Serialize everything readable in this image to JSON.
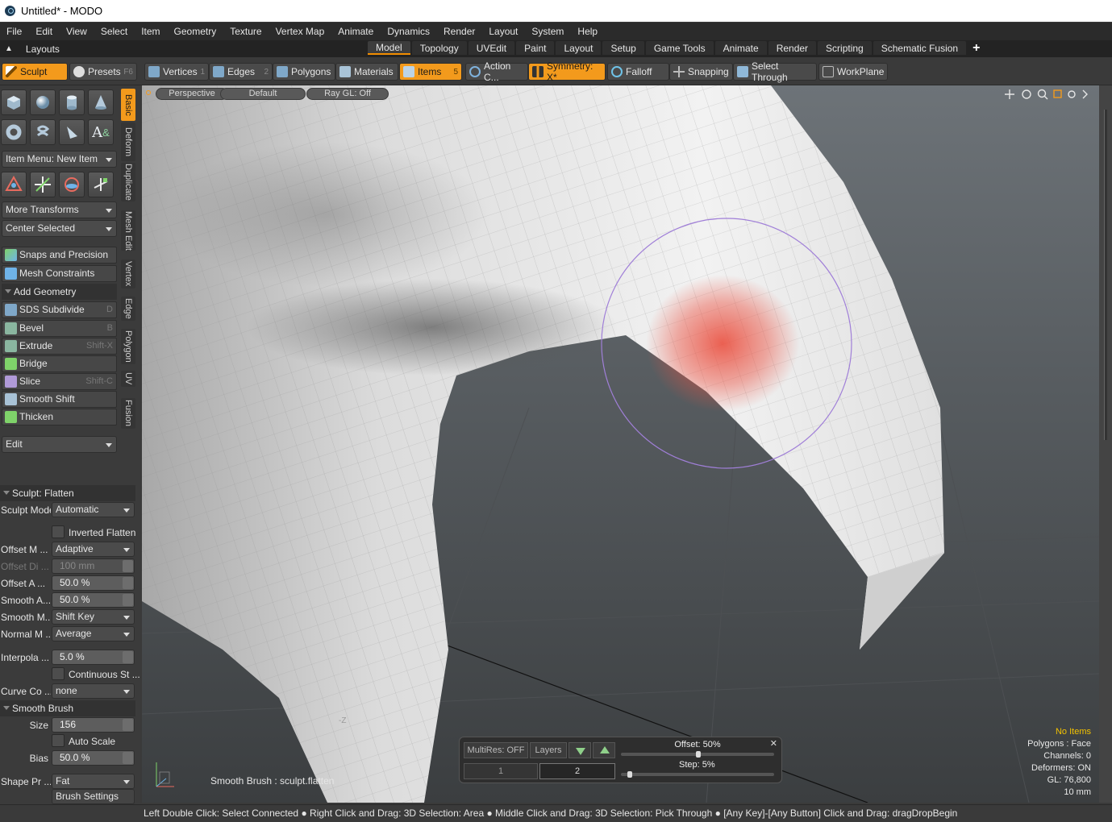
{
  "window": {
    "title": "Untitled* - MODO"
  },
  "menu": [
    "File",
    "Edit",
    "View",
    "Select",
    "Item",
    "Geometry",
    "Texture",
    "Vertex Map",
    "Animate",
    "Dynamics",
    "Render",
    "Layout",
    "System",
    "Help"
  ],
  "layouts_label": "Layouts",
  "layout_tabs": [
    "Model",
    "Topology",
    "UVEdit",
    "Paint",
    "Layout",
    "Setup",
    "Game Tools",
    "Animate",
    "Render",
    "Scripting",
    "Schematic Fusion"
  ],
  "active_layout_tab": "Model",
  "toolbar": {
    "sculpt": "Sculpt",
    "presets": "Presets",
    "presets_key": "F6",
    "vertices": "Vertices",
    "vertices_key": "1",
    "edges": "Edges",
    "edges_key": "2",
    "polygons": "Polygons",
    "materials": "Materials",
    "items": "Items",
    "items_key": "5",
    "action_center": "Action C...",
    "symmetry": "Symmetry: X*",
    "falloff": "Falloff",
    "snapping": "Snapping",
    "select_through": "Select Through",
    "workplane": "WorkPlane"
  },
  "left_panel": {
    "item_menu": "Item Menu: New Item",
    "more_transforms": "More Transforms",
    "center_selected": "Center Selected",
    "snaps": "Snaps and Precision",
    "mesh_constraints": "Mesh Constraints",
    "add_geometry": "Add Geometry",
    "tools": [
      {
        "label": "SDS Subdivide",
        "key": "D"
      },
      {
        "label": "Bevel",
        "key": "B"
      },
      {
        "label": "Extrude",
        "key": "Shift-X"
      },
      {
        "label": "Bridge",
        "key": ""
      },
      {
        "label": "Slice",
        "key": "Shift-C"
      },
      {
        "label": "Smooth Shift",
        "key": ""
      },
      {
        "label": "Thicken",
        "key": ""
      }
    ],
    "edit": "Edit"
  },
  "vertical_tabs": [
    "Basic",
    "Deform",
    "Duplicate",
    "Mesh Edit",
    "Vertex",
    "Edge",
    "Polygon",
    "UV",
    "Fusion"
  ],
  "sculpt_props": {
    "header": "Sculpt: Flatten",
    "sculpt_mode_label": "Sculpt Mode",
    "sculpt_mode": "Automatic",
    "inverted_flatten": "Inverted Flatten",
    "offset_mode_label": "Offset M ...",
    "offset_mode": "Adaptive",
    "offset_dist_label": "Offset Di ...",
    "offset_dist": "100 mm",
    "offset_amount_label": "Offset A ...",
    "offset_amount": "50.0 %",
    "smooth_amount_label": "Smooth A...",
    "smooth_amount": "50.0 %",
    "smooth_mode_label": "Smooth M...",
    "smooth_mode": "Shift Key",
    "normal_mode_label": "Normal M ...",
    "normal_mode": "Average",
    "interp_label": "Interpola ...",
    "interp": "5.0 %",
    "continuous": "Continuous St ...",
    "curve_label": "Curve Co ...",
    "curve": "none",
    "smooth_brush": "Smooth Brush",
    "size_label": "Size",
    "size": "156",
    "auto_scale": "Auto Scale",
    "bias_label": "Bias",
    "bias": "50.0 %",
    "shape_label": "Shape Pr ...",
    "shape": "Fat",
    "brush_settings": "Brush Settings"
  },
  "viewport": {
    "view": "Perspective",
    "shading": "Default",
    "raygl": "Ray GL: Off",
    "brush_text": "Smooth Brush : sculpt.flatten",
    "axis_label": "-Z",
    "multires": "MultiRes: OFF",
    "layers": "Layers",
    "level1": "1",
    "level2": "2",
    "offset": "Offset:  50%",
    "step": "Step:  5%",
    "info": {
      "no_items": "No Items",
      "polygons": "Polygons : Face",
      "channels": "Channels: 0",
      "deformers": "Deformers: ON",
      "gl": "GL: 76,800",
      "scale": "10 mm"
    }
  },
  "status": "Left Double Click: Select Connected ● Right Click and Drag: 3D Selection: Area ● Middle Click and Drag: 3D Selection: Pick Through ● [Any Key]-[Any Button] Click and Drag: dragDropBegin",
  "colors": {
    "accent": "#f39a1c",
    "brush": "#e8554a",
    "panel": "#3b3b3b"
  }
}
